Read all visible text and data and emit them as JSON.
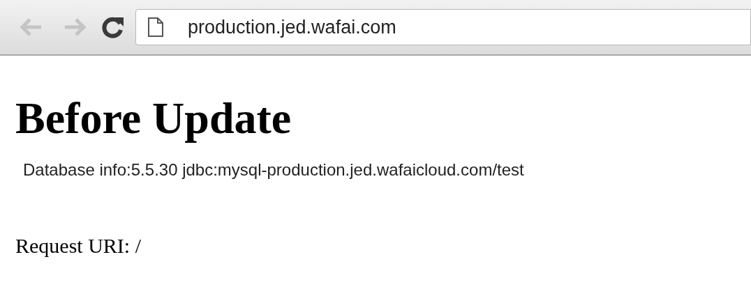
{
  "toolbar": {
    "back": {
      "disabled": true
    },
    "forward": {
      "disabled": true
    },
    "reload": {
      "disabled": false
    },
    "url": "production.jed.wafai.com"
  },
  "page": {
    "heading": "Before Update",
    "database_info": "Database info:5.5.30 jdbc:mysql-production.jed.wafaicloud.com/test",
    "request_uri": "Request URI: /"
  }
}
